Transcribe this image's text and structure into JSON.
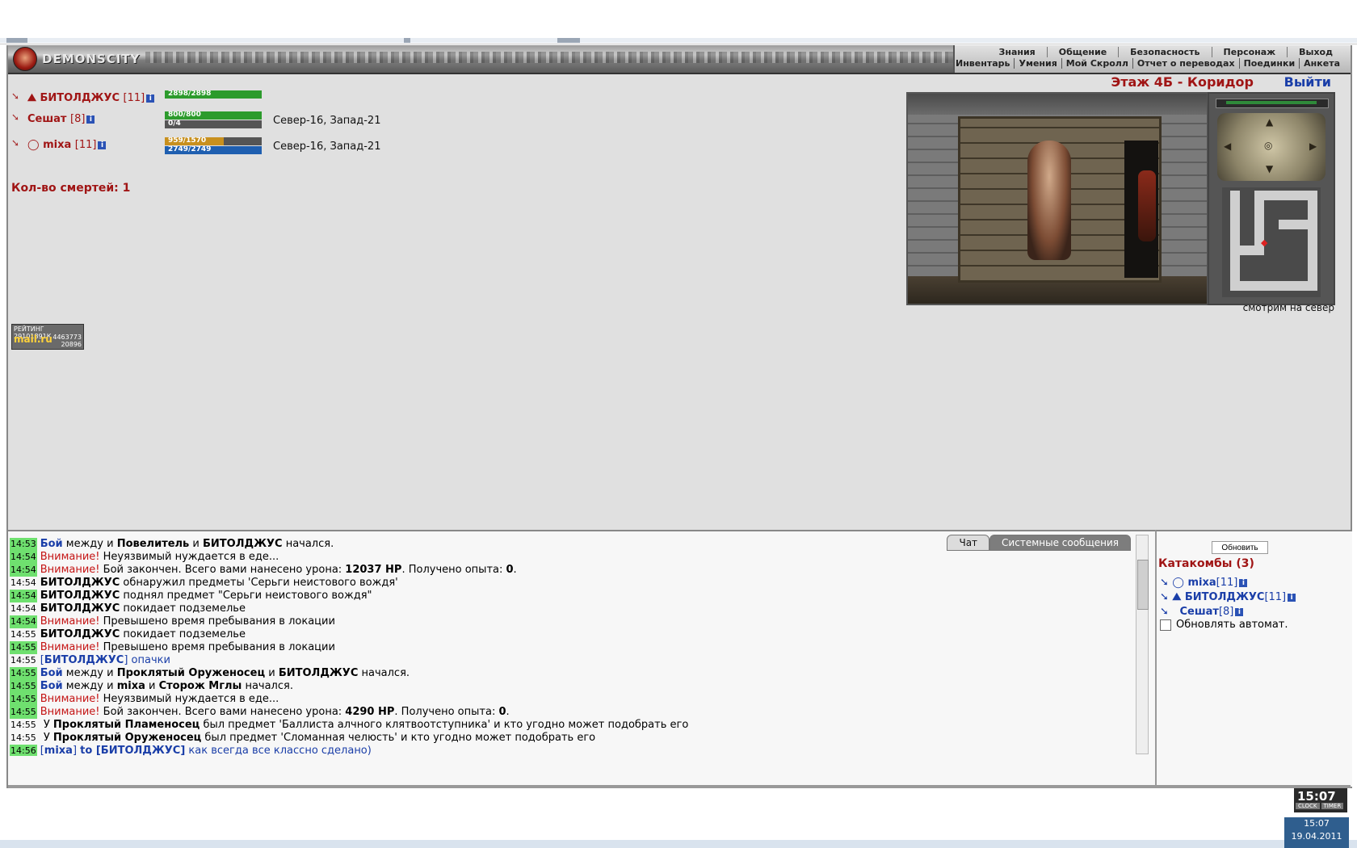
{
  "header": {
    "logo_text": "DEMONSCITY",
    "menu_top": [
      "Знания",
      "Общение",
      "Безопасность",
      "Персонаж",
      "Выход"
    ],
    "menu_bottom": [
      "Инвентарь",
      "Умения",
      "Мой Скролл",
      "Отчет о переводах",
      "Поединки",
      "Анкета"
    ]
  },
  "players": [
    {
      "name": "БИТОЛДЖУС",
      "level": "[11]",
      "hp": "2898/2898",
      "hp_fill": 1.0,
      "mp": "",
      "mp_fill": 0,
      "coords": ""
    },
    {
      "name": "Сешат",
      "level": "[8]",
      "hp": "800/800",
      "hp_fill": 1.0,
      "mp": "0/4",
      "mp_fill": 0,
      "coords": "Север-16, Запад-21"
    },
    {
      "name": "mixa",
      "level": "[11]",
      "hp": "959/1570",
      "hp_fill": 0.61,
      "mp": "2749/2749",
      "mp_fill": 1.0,
      "coords": "Север-16, Запад-21"
    }
  ],
  "deaths": "Кол-во смертей: 1",
  "rating": {
    "title": "РЕЙТИНГ 29101891К",
    "brand": "mail.ru",
    "n1": "4463773",
    "n2": "20896"
  },
  "location": {
    "title": "Этаж 4Б - Коридор",
    "exit": "Выйти",
    "look": "смотрим на север"
  },
  "chat": {
    "tabs": [
      "Чат",
      "Системные сообщения"
    ],
    "lines": [
      {
        "time": "14:53",
        "hl": true,
        "parts": [
          [
            "bl b",
            "Бой"
          ],
          [
            "",
            " между и "
          ],
          [
            "b",
            "Повелитель"
          ],
          [
            "",
            " и "
          ],
          [
            "b",
            "БИТОЛДЖУС"
          ],
          [
            "",
            " начался."
          ]
        ]
      },
      {
        "time": "14:54",
        "hl": true,
        "parts": [
          [
            "w",
            "Внимание!"
          ],
          [
            "",
            " Неуязвимый нуждается в еде..."
          ]
        ]
      },
      {
        "time": "14:54",
        "hl": true,
        "parts": [
          [
            "w",
            "Внимание!"
          ],
          [
            "",
            " Бой закончен. Всего вами нанесено урона: "
          ],
          [
            "b",
            "12037 HP"
          ],
          [
            "",
            ". Получено опыта: "
          ],
          [
            "b",
            "0"
          ],
          [
            "",
            "."
          ]
        ]
      },
      {
        "time": "14:54",
        "hl": false,
        "parts": [
          [
            "b",
            "БИТОЛДЖУС"
          ],
          [
            "",
            " обнаружил предметы 'Серьги неистового вождя'"
          ]
        ]
      },
      {
        "time": "14:54",
        "hl": true,
        "parts": [
          [
            "b",
            "БИТОЛДЖУС"
          ],
          [
            "",
            " поднял предмет \"Серьги неистового вождя\""
          ]
        ]
      },
      {
        "time": "14:54",
        "hl": false,
        "parts": [
          [
            "b",
            "БИТОЛДЖУС"
          ],
          [
            "",
            " покидает подземелье"
          ]
        ]
      },
      {
        "time": "14:54",
        "hl": true,
        "parts": [
          [
            "w",
            "Внимание!"
          ],
          [
            "",
            " Превышено время пребывания в локации"
          ]
        ]
      },
      {
        "time": "14:55",
        "hl": false,
        "parts": [
          [
            "b",
            "БИТОЛДЖУС"
          ],
          [
            "",
            " покидает подземелье"
          ]
        ]
      },
      {
        "time": "14:55",
        "hl": true,
        "parts": [
          [
            "w",
            "Внимание!"
          ],
          [
            "",
            " Превышено время пребывания в локации"
          ]
        ]
      },
      {
        "time": "14:55",
        "hl": false,
        "parts": [
          [
            "bl",
            "["
          ],
          [
            "bb",
            "БИТОЛДЖУС"
          ],
          [
            "bl",
            "] опачки"
          ]
        ]
      },
      {
        "time": "14:55",
        "hl": true,
        "parts": [
          [
            "bb",
            "Бой"
          ],
          [
            "",
            " между и "
          ],
          [
            "b",
            "Проклятый Оруженосец"
          ],
          [
            "",
            " и "
          ],
          [
            "b",
            "БИТОЛДЖУС"
          ],
          [
            "",
            " начался."
          ]
        ]
      },
      {
        "time": "14:55",
        "hl": true,
        "parts": [
          [
            "bb",
            "Бой"
          ],
          [
            "",
            " между и "
          ],
          [
            "b",
            "mixa"
          ],
          [
            "",
            " и "
          ],
          [
            "b",
            "Сторож Мглы"
          ],
          [
            "",
            " начался."
          ]
        ]
      },
      {
        "time": "14:55",
        "hl": true,
        "parts": [
          [
            "w",
            "Внимание!"
          ],
          [
            "",
            " Неуязвимый нуждается в еде..."
          ]
        ]
      },
      {
        "time": "14:55",
        "hl": true,
        "parts": [
          [
            "w",
            "Внимание!"
          ],
          [
            "",
            " Бой закончен. Всего вами нанесено урона: "
          ],
          [
            "b",
            "4290 HP"
          ],
          [
            "",
            ". Получено опыта: "
          ],
          [
            "b",
            "0"
          ],
          [
            "",
            "."
          ]
        ]
      },
      {
        "time": "14:55",
        "hl": false,
        "parts": [
          [
            "",
            " У "
          ],
          [
            "b",
            "Проклятый Пламеносец"
          ],
          [
            "",
            " был предмет 'Баллиста алчного клятвоотступника' и кто угодно может подобрать его"
          ]
        ]
      },
      {
        "time": "14:55",
        "hl": false,
        "parts": [
          [
            "",
            " У "
          ],
          [
            "b",
            "Проклятый Оруженосец"
          ],
          [
            "",
            " был предмет 'Сломанная челюсть' и кто угодно может подобрать его"
          ]
        ]
      },
      {
        "time": "14:56",
        "hl": true,
        "parts": [
          [
            "bl",
            "["
          ],
          [
            "bl b",
            "mixa"
          ],
          [
            "bl",
            "] "
          ],
          [
            "bb",
            "to [БИТОЛДЖУС]"
          ],
          [
            "bl",
            " как всегда все классно сделано)"
          ]
        ]
      }
    ]
  },
  "side": {
    "refresh": "Обновить",
    "category": "Катакомбы (3)",
    "members": [
      {
        "name": "mixa",
        "level": "[11]"
      },
      {
        "name": "БИТОЛДЖУС",
        "level": "[11]"
      },
      {
        "name": "Сешат",
        "level": "[8]"
      }
    ],
    "auto_label": "Обновлять автомат."
  },
  "clock": {
    "big": "15:07",
    "clock_label": "CLOCK",
    "timer_label": "TIMER",
    "time": "15:07",
    "date": "19.04.2011"
  }
}
